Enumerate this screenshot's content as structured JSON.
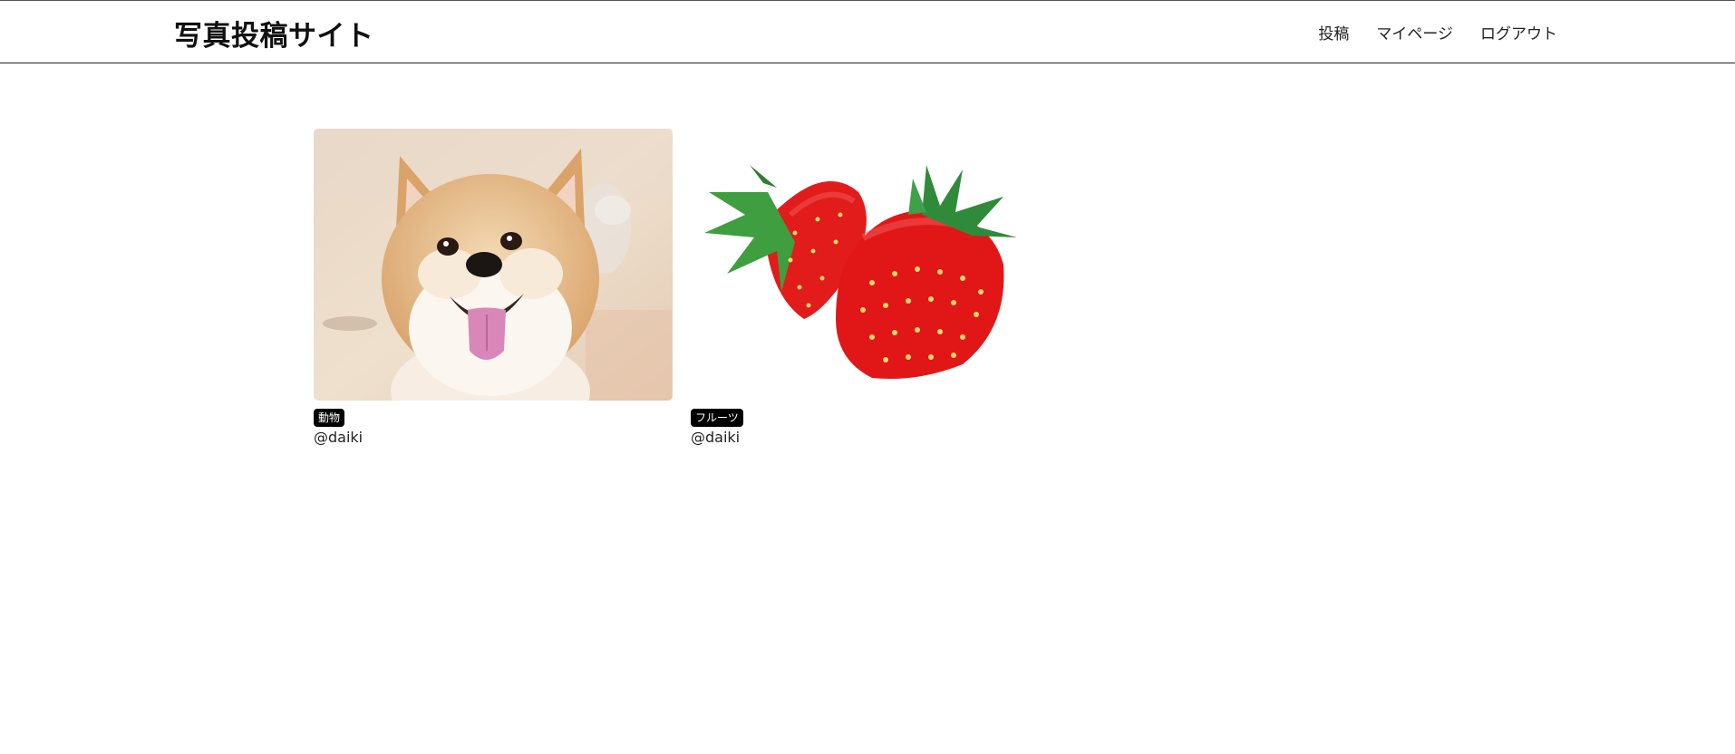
{
  "header": {
    "site_title": "写真投稿サイト",
    "nav": [
      {
        "label": "投稿"
      },
      {
        "label": "マイページ"
      },
      {
        "label": "ログアウト"
      }
    ]
  },
  "posts": [
    {
      "image": "shiba-dog-photo",
      "tag": "動物",
      "user": "@daiki"
    },
    {
      "image": "strawberries-photo",
      "tag": "フルーツ",
      "user": "@daiki"
    }
  ]
}
